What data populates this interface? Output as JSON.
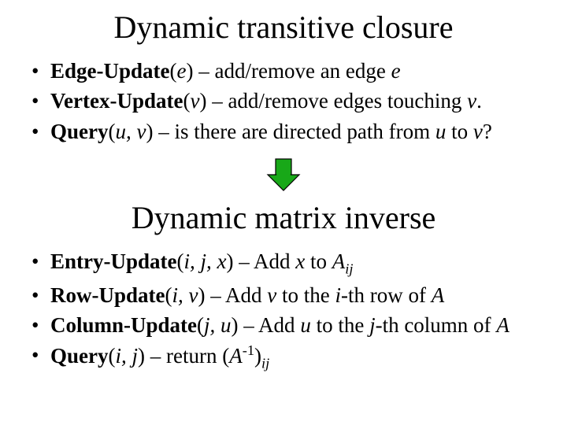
{
  "section1": {
    "title": "Dynamic transitive closure",
    "items": [
      {
        "op": "Edge-Update",
        "args": "e",
        "desc_a": " – add/remove an edge ",
        "desc_b": "e",
        "desc_c": ""
      },
      {
        "op": "Vertex-Update",
        "args": "v",
        "desc_a": " – add/remove edges touching ",
        "desc_b": "v",
        "desc_c": "."
      },
      {
        "op": "Query",
        "args": "u, v",
        "desc_a": " – is there are directed path from ",
        "desc_b": "u",
        "desc_c": " to ",
        "desc_d": "v",
        "desc_e": "?"
      }
    ]
  },
  "arrow": {
    "name": "down-arrow"
  },
  "section2": {
    "title": "Dynamic matrix inverse",
    "items": [
      {
        "op": "Entry-Update",
        "args": "i, j, x",
        "pre": " – Add ",
        "val": "x",
        "mid": " to ",
        "A": "A",
        "sub": "ij",
        "post": ""
      },
      {
        "op": "Row-Update",
        "args": "i, v",
        "pre": " – Add ",
        "val": "v",
        "mid": " to the ",
        "idx": "i",
        "ord": "-th row of ",
        "A": "A"
      },
      {
        "op": "Column-Update",
        "args": "j, u",
        "pre": " – Add ",
        "val": "u",
        "mid": " to the ",
        "idx": "j",
        "ord": "-th column of ",
        "A": "A"
      },
      {
        "op": "Query",
        "args": "i, j",
        "pre": " – return (",
        "A": "A",
        "sup": "-1",
        "close": ")",
        "sub": "ij"
      }
    ]
  }
}
